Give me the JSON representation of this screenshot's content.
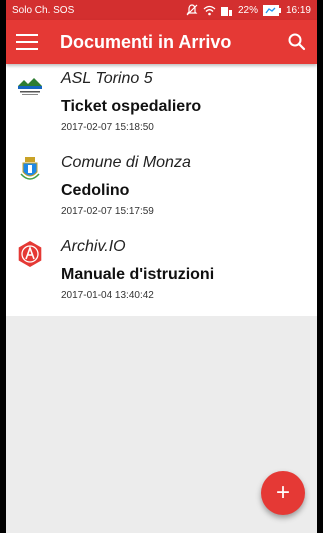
{
  "status_bar": {
    "carrier": "Solo Ch. SOS",
    "battery_percent": "22%",
    "time": "16:19"
  },
  "toolbar": {
    "title": "Documenti in Arrivo"
  },
  "documents": [
    {
      "sender": "ASL Torino 5",
      "title": "Ticket ospedaliero",
      "date": "2017-02-07 15:18:50",
      "icon": "asl-logo-icon"
    },
    {
      "sender": "Comune di Monza",
      "title": "Cedolino",
      "date": "2017-02-07 15:17:59",
      "icon": "monza-crest-icon"
    },
    {
      "sender": "Archiv.IO",
      "title": "Manuale d'istruzioni",
      "date": "2017-01-04 13:40:42",
      "icon": "archivio-logo-icon"
    }
  ],
  "fab": {
    "label": "+"
  },
  "colors": {
    "primary": "#e53935",
    "status_bar": "#d32f2f"
  }
}
